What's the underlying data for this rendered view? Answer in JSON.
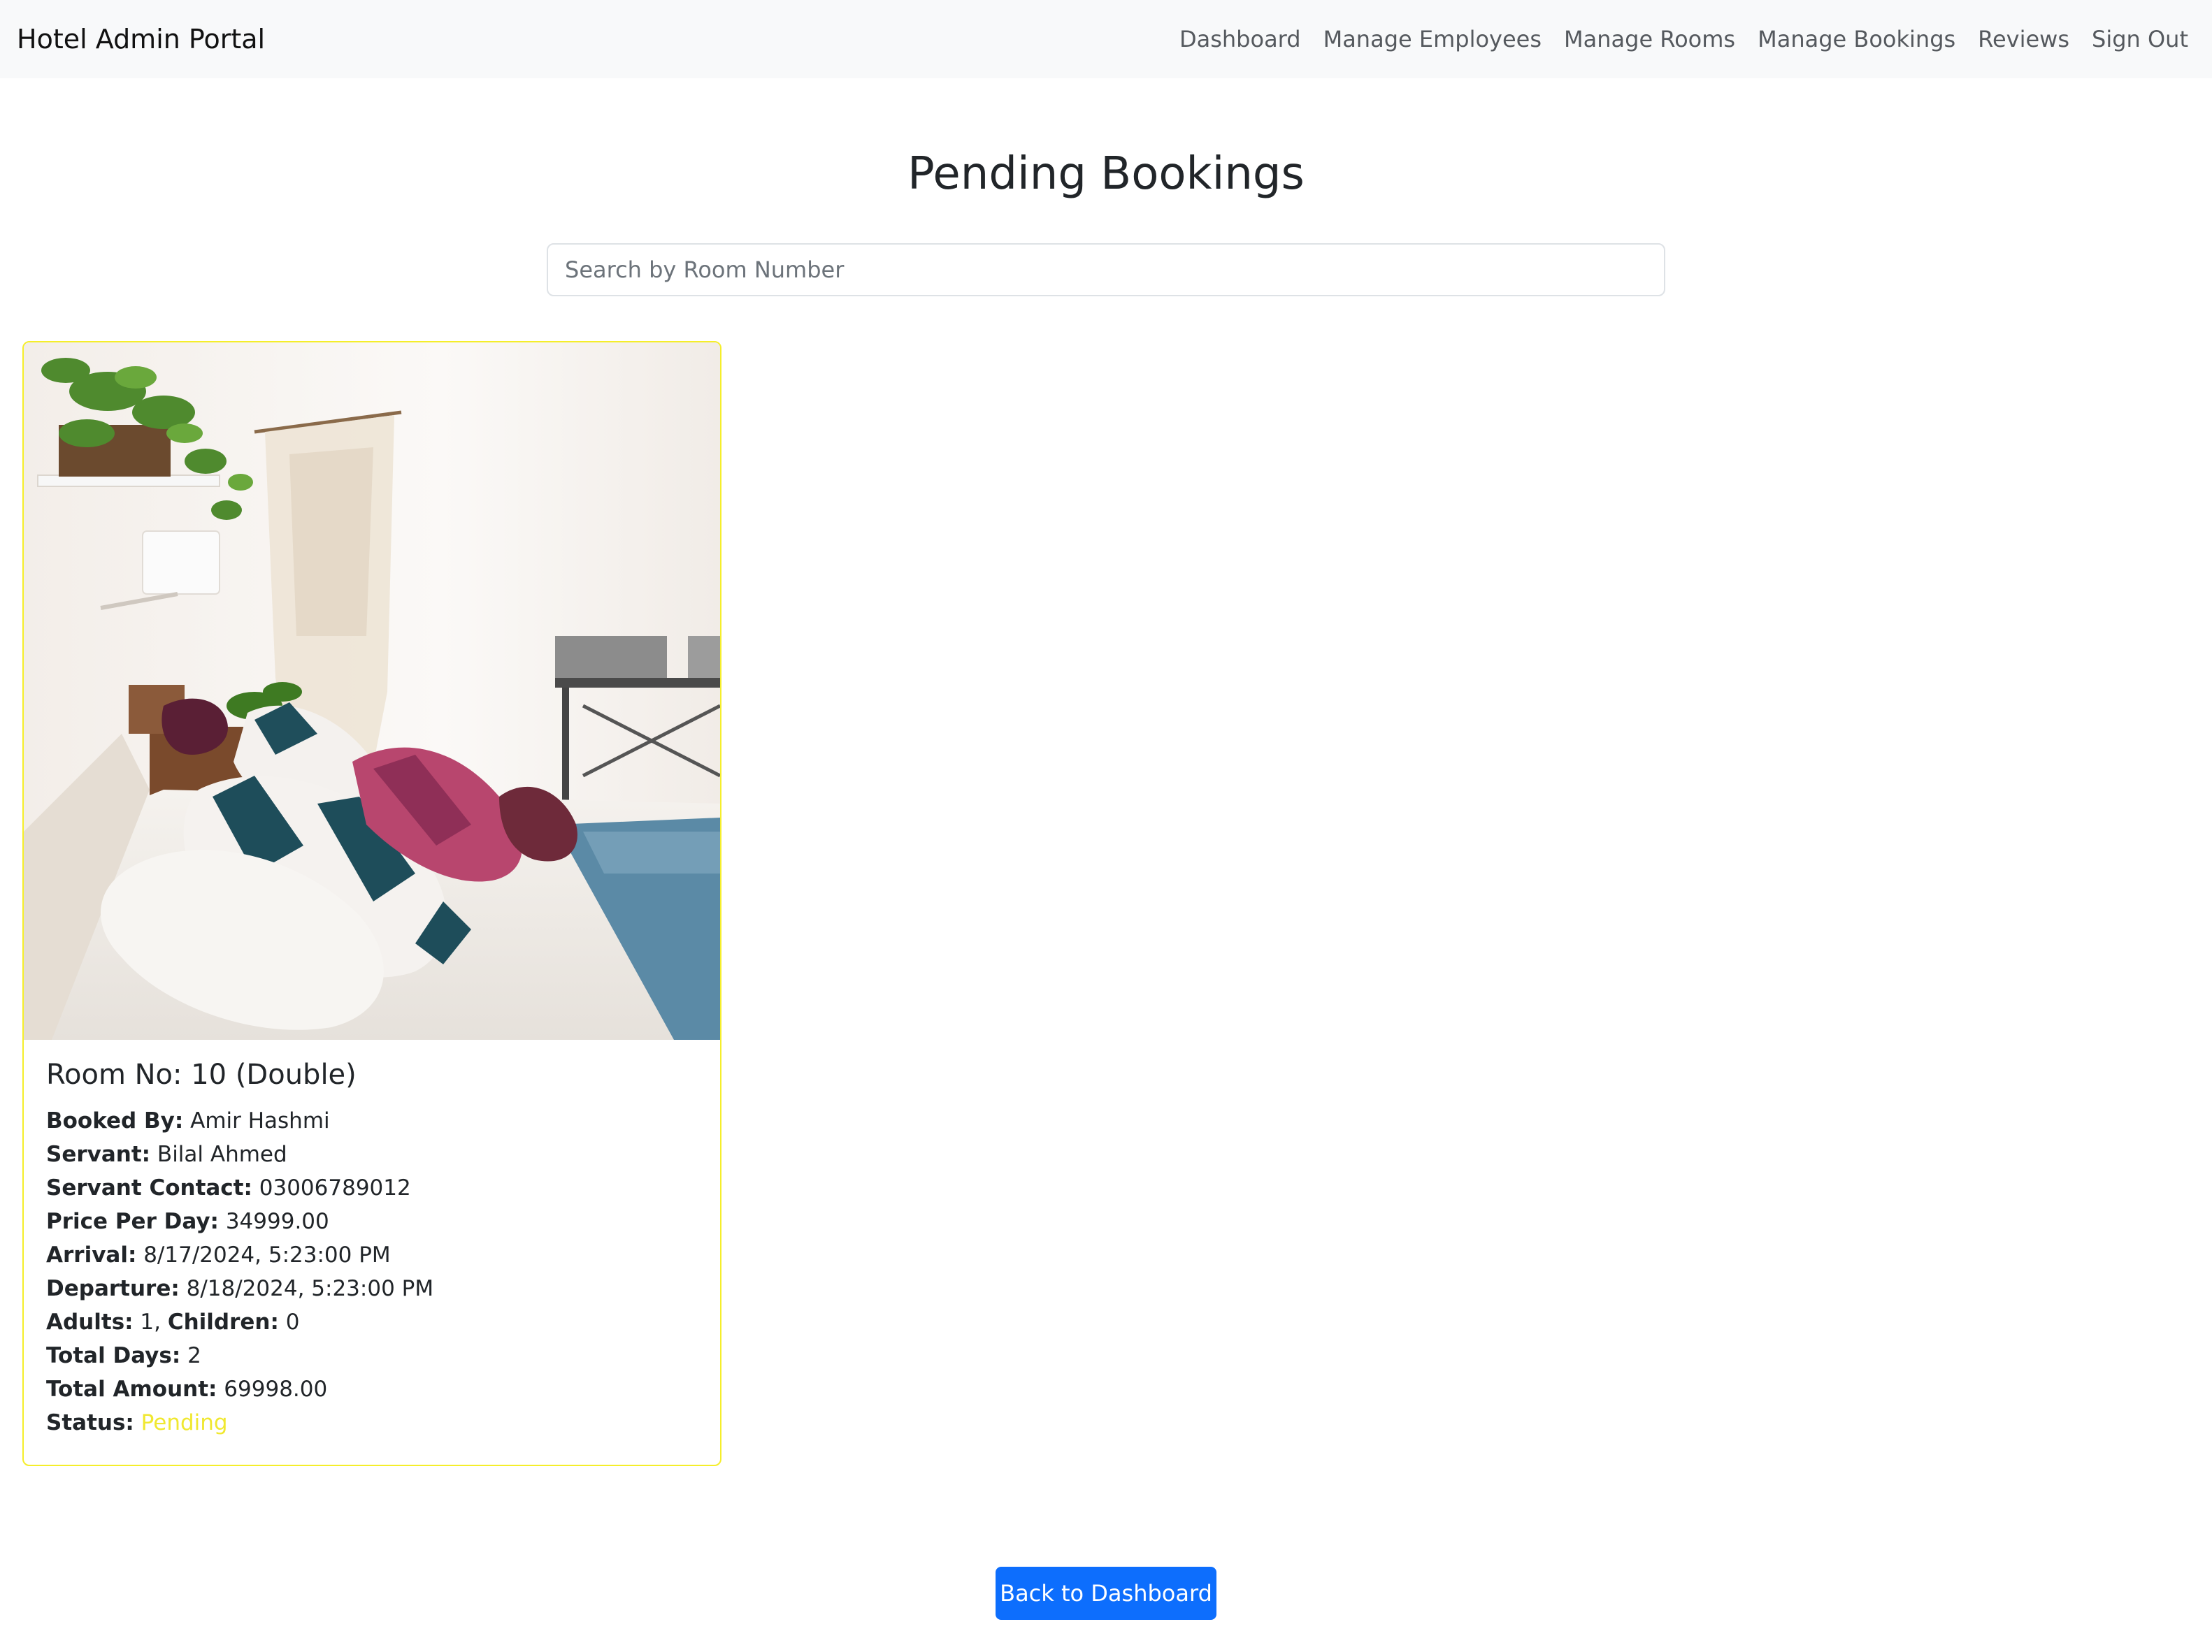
{
  "navbar": {
    "brand": "Hotel Admin Portal",
    "links": [
      "Dashboard",
      "Manage Employees",
      "Manage Rooms",
      "Manage Bookings",
      "Reviews",
      "Sign Out"
    ]
  },
  "page": {
    "title": "Pending Bookings"
  },
  "search": {
    "placeholder": "Search by Room Number",
    "value": ""
  },
  "booking": {
    "image": "room-photo",
    "title": "Room No: 10 (Double)",
    "labels": {
      "booked_by": "Booked By:",
      "servant": "Servant:",
      "servant_contact": "Servant Contact:",
      "price_per_day": "Price Per Day:",
      "arrival": "Arrival:",
      "departure": "Departure:",
      "adults": "Adults:",
      "children": "Children:",
      "total_days": "Total Days:",
      "total_amount": "Total Amount:",
      "status": "Status:"
    },
    "booked_by": "Amir Hashmi",
    "servant": "Bilal Ahmed",
    "servant_contact": "03006789012",
    "price_per_day": "34999.00",
    "arrival": "8/17/2024, 5:23:00 PM",
    "departure": "8/18/2024, 5:23:00 PM",
    "adults": "1",
    "children": "0",
    "total_days": "2",
    "total_amount": "69998.00",
    "status": "Pending"
  },
  "actions": {
    "back_label": "Back to Dashboard"
  },
  "colors": {
    "primary": "#0d6efd",
    "pending": "#f0e830",
    "card_border": "#f5ee2a",
    "navbar_bg": "#f8f9fa"
  }
}
